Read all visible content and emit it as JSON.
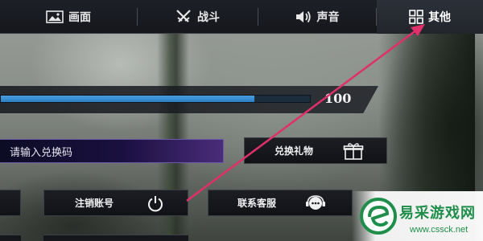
{
  "tabs": [
    {
      "label": "画面",
      "icon": "image-icon"
    },
    {
      "label": "战斗",
      "icon": "crossed-swords-icon"
    },
    {
      "label": "声音",
      "icon": "speaker-icon"
    },
    {
      "label": "其他",
      "icon": "grid-icon",
      "active": true
    }
  ],
  "slider": {
    "value": "100",
    "fill_fraction": 0.82
  },
  "redeem": {
    "placeholder": "请输入兑换码"
  },
  "buttons": {
    "gift": {
      "label": "兑换礼物",
      "icon": "gift-icon"
    },
    "logout": {
      "label": "注销账号",
      "icon": "power-icon"
    },
    "support": {
      "label": "联系客服",
      "icon": "headset-icon"
    }
  },
  "annotation": {
    "color": "#e0306a",
    "icon": "arrow-icon"
  },
  "watermark": {
    "title": "易采游戏网",
    "url": "www.cssck.net",
    "color": "#1e8e4a"
  }
}
